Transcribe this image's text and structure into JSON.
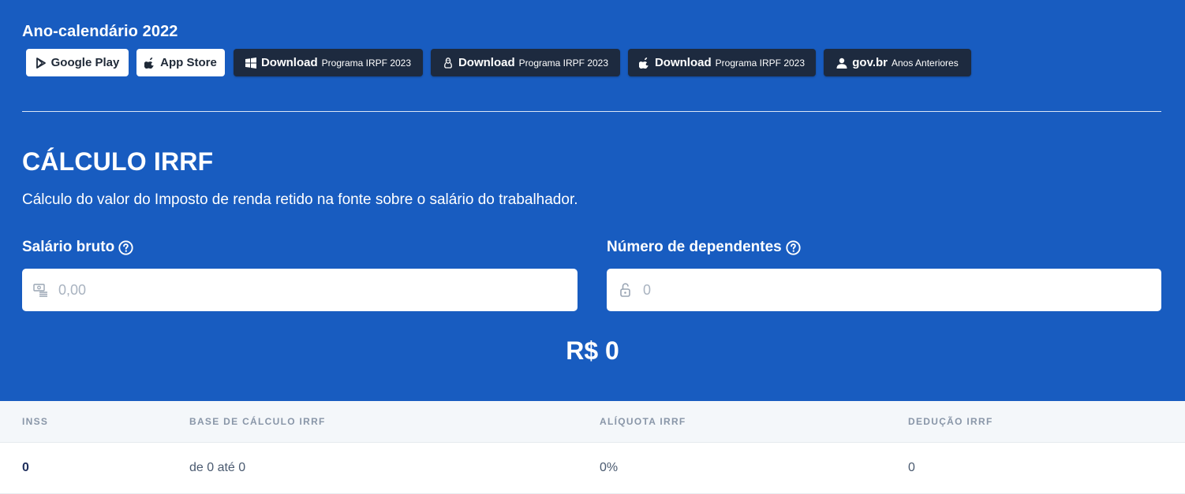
{
  "header": {
    "year_title": "Ano-calendário 2022"
  },
  "buttons": {
    "google_play": {
      "label": "Google Play",
      "icon": "play-icon"
    },
    "app_store": {
      "label": "App Store",
      "icon": "apple-icon"
    },
    "download_windows": {
      "main": "Download",
      "sub": "Programa IRPF 2023",
      "icon": "windows-icon"
    },
    "download_linux": {
      "main": "Download",
      "sub": "Programa IRPF 2023",
      "icon": "linux-icon"
    },
    "download_mac": {
      "main": "Download",
      "sub": "Programa IRPF 2023",
      "icon": "apple-icon"
    },
    "govbr": {
      "main": "gov.br",
      "sub": "Anos Anteriores",
      "icon": "user-icon"
    }
  },
  "calculator": {
    "title": "CÁLCULO IRRF",
    "description": "Cálculo do valor do Imposto de renda retido na fonte sobre o salário do trabalhador.",
    "salary": {
      "label": "Salário bruto",
      "placeholder": "0,00",
      "value": "",
      "icon": "money-icon"
    },
    "dependents": {
      "label": "Número de dependentes",
      "placeholder": "0",
      "value": "",
      "icon": "lock-open-icon"
    },
    "result": "R$ 0"
  },
  "table": {
    "headers": [
      "INSS",
      "BASE DE CÁLCULO IRRF",
      "ALÍQUOTA IRRF",
      "DEDUÇÃO IRRF"
    ],
    "rows": [
      [
        "0",
        "de 0 até 0",
        "0%",
        "0"
      ]
    ]
  },
  "colors": {
    "hero_background": "#185cc0",
    "dark_button": "#1d2a3f",
    "table_header_bg": "#f4f7fa"
  }
}
